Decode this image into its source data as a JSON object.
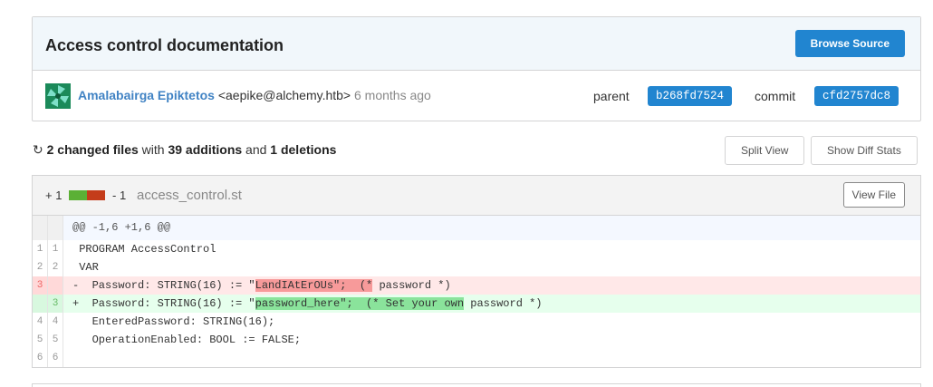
{
  "commit": {
    "title": "Access control documentation",
    "browse_source_label": "Browse Source",
    "author_name": "Amalabairga Epiktetos",
    "author_email": "<aepike@alchemy.htb>",
    "time_ago": "6 months ago",
    "parent_label": "parent",
    "parent_sha": "b268fd7524",
    "commit_label": "commit",
    "commit_sha": "cfd2757dc8"
  },
  "stats": {
    "changed": "2 changed files",
    "with": "with",
    "additions": "39 additions",
    "and": "and",
    "deletions": "1 deletions",
    "split_view_label": "Split View",
    "show_diff_stats_label": "Show Diff Stats"
  },
  "file": {
    "additions": "+ 1",
    "deletions": "- 1",
    "name": "access_control.st",
    "view_file_label": "View File",
    "hunk_header": "@@ -1,6 +1,6 @@",
    "lines": [
      {
        "type": "context",
        "old": "1",
        "new": "1",
        "text": " PROGRAM AccessControl"
      },
      {
        "type": "context",
        "old": "2",
        "new": "2",
        "text": " VAR"
      },
      {
        "type": "del",
        "old": "3",
        "new": "",
        "prefix": "-  Password: STRING(16) := \"",
        "highlight": "LandIAtErOUs\";  (*",
        "suffix": " password *)"
      },
      {
        "type": "add",
        "old": "",
        "new": "3",
        "prefix": "+  Password: STRING(16) := \"",
        "highlight": "password_here\";  (* Set your own",
        "suffix": " password *)"
      },
      {
        "type": "context",
        "old": "4",
        "new": "4",
        "text": "   EnteredPassword: STRING(16);"
      },
      {
        "type": "context",
        "old": "5",
        "new": "5",
        "text": "   OperationEnabled: BOOL := FALSE;"
      },
      {
        "type": "context",
        "old": "6",
        "new": "6",
        "text": ""
      }
    ]
  },
  "colors": {
    "primary": "#2185d0",
    "author_link": "#4183c4",
    "addition_bar": "#5bb035",
    "deletion_bar": "#c43c1a"
  }
}
